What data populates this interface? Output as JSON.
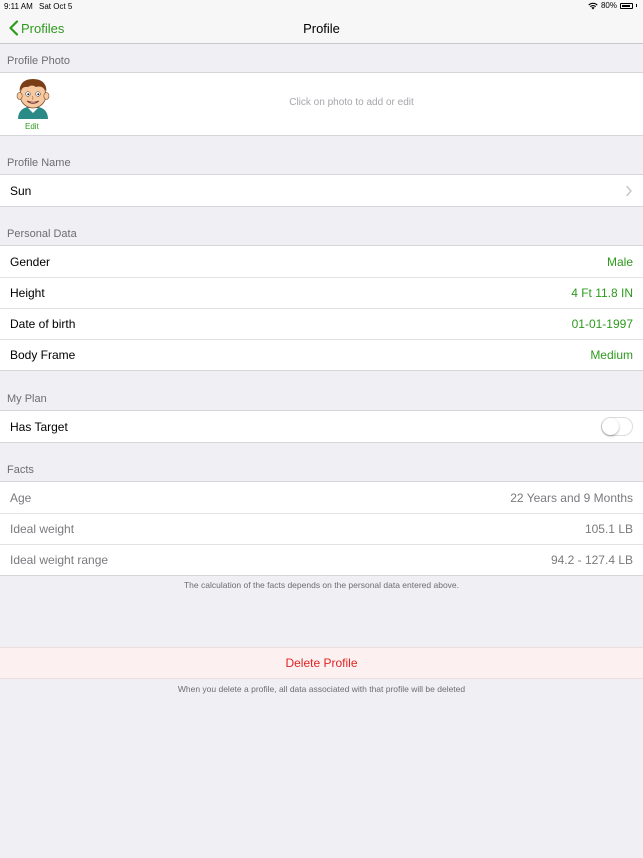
{
  "status_bar": {
    "time": "9:11 AM",
    "date": "Sat Oct 5",
    "battery": "80%"
  },
  "nav": {
    "back_label": "Profiles",
    "title": "Profile"
  },
  "profile_photo": {
    "header": "Profile Photo",
    "edit_label": "Edit",
    "hint": "Click on photo to add or edit"
  },
  "profile_name": {
    "header": "Profile Name",
    "value": "Sun"
  },
  "personal_data": {
    "header": "Personal Data",
    "rows": [
      {
        "label": "Gender",
        "value": "Male"
      },
      {
        "label": "Height",
        "value": "4 Ft 11.8 IN"
      },
      {
        "label": "Date of birth",
        "value": "01-01-1997"
      },
      {
        "label": "Body Frame",
        "value": "Medium"
      }
    ]
  },
  "my_plan": {
    "header": "My  Plan",
    "has_target_label": "Has Target",
    "has_target_on": false
  },
  "facts": {
    "header": "Facts",
    "rows": [
      {
        "label": "Age",
        "value": "22 Years and 9 Months"
      },
      {
        "label": "Ideal weight",
        "value": "105.1 LB"
      },
      {
        "label": "Ideal weight range",
        "value": "94.2 - 127.4 LB"
      }
    ],
    "footnote": "The calculation of the facts depends on the personal data entered above."
  },
  "delete": {
    "label": "Delete Profile",
    "footnote": "When you delete a profile, all data associated with that profile will be deleted"
  },
  "colors": {
    "accent": "#2e9a1e",
    "destructive": "#e02424",
    "background": "#efeff4"
  }
}
